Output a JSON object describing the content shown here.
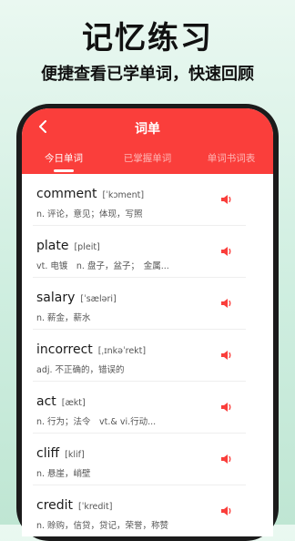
{
  "headline": "记忆练习",
  "subline": "便捷查看已学单词，快速回顾",
  "colors": {
    "accent": "#fa3e3b",
    "background_top": "#eaf8f1",
    "background_bottom": "#bfe6d3"
  },
  "appbar": {
    "back_icon": "chevron-left-icon",
    "title": "词单"
  },
  "tabs": [
    {
      "label": "今日单词",
      "active": true
    },
    {
      "label": "已掌握单词",
      "active": false
    },
    {
      "label": "单词书词表",
      "active": false
    }
  ],
  "words": [
    {
      "word": "comment",
      "phonetic": "[ˈkɔment]",
      "definition": "n. 评论，意见；体现，写照",
      "icon": "speaker-icon"
    },
    {
      "word": "plate",
      "phonetic": "[pleit]",
      "definition": "vt. 电镀　n. 盘子，盆子；　金属...",
      "icon": "speaker-icon"
    },
    {
      "word": "salary",
      "phonetic": "[ˈsæləri]",
      "definition": "n. 薪金，薪水",
      "icon": "speaker-icon"
    },
    {
      "word": "incorrect",
      "phonetic": "[ˌɪnkəˈrekt]",
      "definition": "adj. 不正确的，错误的",
      "icon": "speaker-icon"
    },
    {
      "word": "act",
      "phonetic": "[ækt]",
      "definition": "n. 行为；法令　vt.& vi.行动...",
      "icon": "speaker-icon"
    },
    {
      "word": "cliff",
      "phonetic": "[klif]",
      "definition": "n. 悬崖，峭壁",
      "icon": "speaker-icon"
    },
    {
      "word": "credit",
      "phonetic": "[ˈkredit]",
      "definition": "n. 赊购，信贷，贷记，荣誉，称赞",
      "icon": "speaker-icon"
    }
  ]
}
